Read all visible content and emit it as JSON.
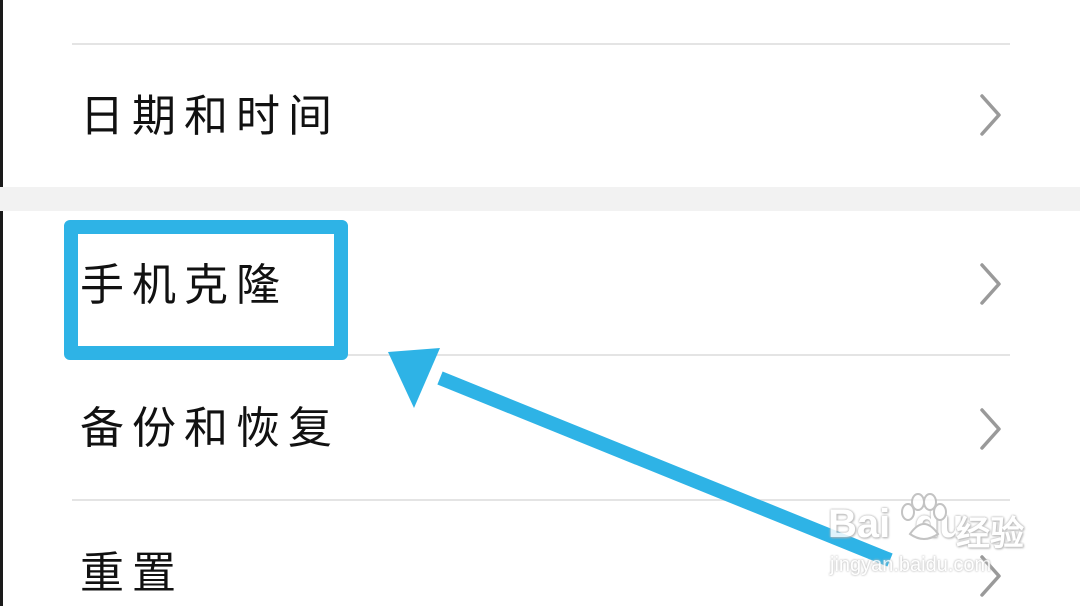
{
  "settings_list": {
    "items": [
      {
        "label": "日期和时间",
        "icon": "chevron-right-icon"
      },
      {
        "label": "手机克隆",
        "icon": "chevron-right-icon"
      },
      {
        "label": "备份和恢复",
        "icon": "chevron-right-icon"
      },
      {
        "label": "重置",
        "icon": "chevron-right-icon"
      }
    ]
  },
  "annotation": {
    "highlighted_item": "手机克隆",
    "color": "#2eb3e6"
  },
  "watermark": {
    "logo": "Bai",
    "logo_suffix": "du",
    "product": "经验",
    "url": "jingyan.baidu.com"
  },
  "colors": {
    "background": "#ffffff",
    "divider": "#e4e4e4",
    "section_gap": "#f2f2f2",
    "chevron": "#9a9a9a",
    "annotation": "#2eb3e6"
  }
}
